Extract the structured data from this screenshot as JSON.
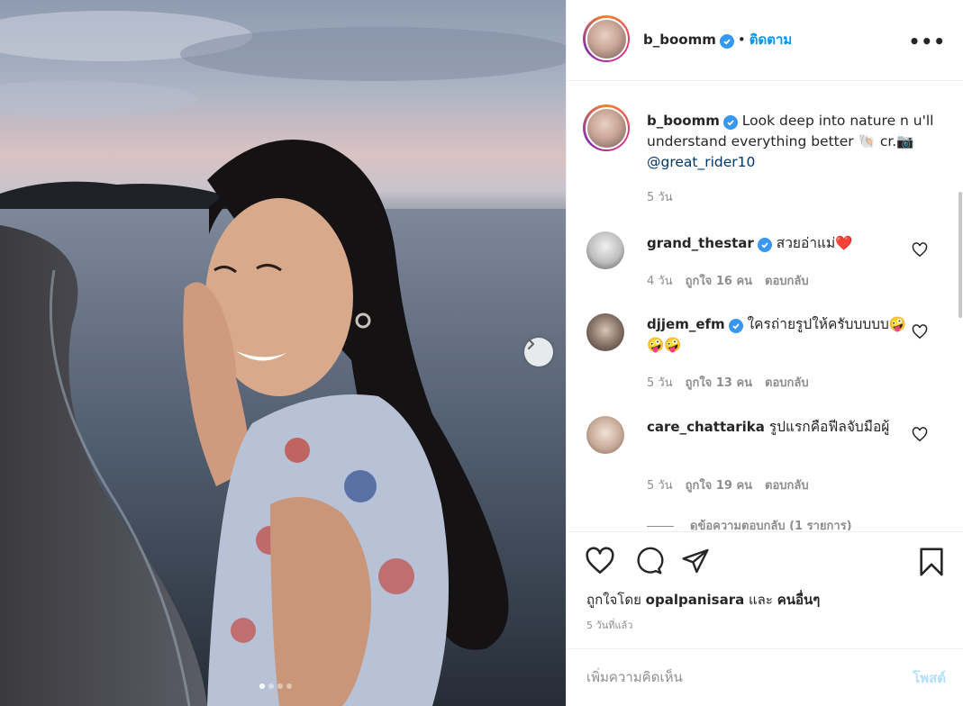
{
  "post": {
    "username": "b_boomm",
    "follow_label": "ติดตาม",
    "more_icon": "more-horizontal-icon",
    "carousel": {
      "total": 4,
      "current": 1
    }
  },
  "caption": {
    "username": "b_boomm",
    "text": "Look deep into nature n u'll understand everything better 🐚 cr.📷",
    "mention": "@great_rider10",
    "time": "5 วัน"
  },
  "comments": [
    {
      "username": "grand_thestar",
      "verified": true,
      "text": "สวยอ่าแม่❤️",
      "time": "4 วัน",
      "likes": "ถูกใจ 16 คน",
      "reply": "ตอบกลับ"
    },
    {
      "username": "djjem_efm",
      "verified": true,
      "text": "ใครถ่ายรูปให้ครับบบบบ🤪🤪🤪",
      "time": "5 วัน",
      "likes": "ถูกใจ 13 คน",
      "reply": "ตอบกลับ"
    },
    {
      "username": "care_chattarika",
      "verified": false,
      "text": "รูปแรกคือฟีลจับมือผู้",
      "time": "5 วัน",
      "likes": "ถูกใจ 19 คน",
      "reply": "ตอบกลับ"
    }
  ],
  "view_replies": "ดูข้อความตอบกลับ (1 รายการ)",
  "likes": {
    "prefix": "ถูกใจโดย",
    "user": "opalpanisara",
    "conj": "และ",
    "others": "คนอื่นๆ"
  },
  "post_time": "5 วันที่แล้ว",
  "add_comment": {
    "placeholder": "เพิ่มความคิดเห็น",
    "post_label": "โพสต์"
  },
  "colors": {
    "accent": "#0095f6",
    "verified": "#3897f0",
    "like_red": "#ed4956"
  }
}
